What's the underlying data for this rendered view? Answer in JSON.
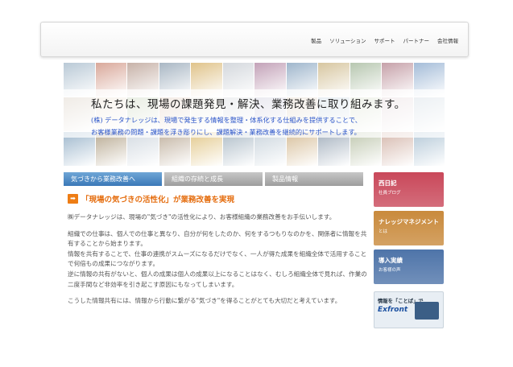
{
  "nav": [
    "製品",
    "ソリューション",
    "サポート",
    "パートナー",
    "会社情報"
  ],
  "hero": {
    "title": "私たちは、現場の課題発見・解決、業務改善に取り組みます。",
    "sub1": "(株) データナレッジは、現場で発生する情報を整理・体系化する仕組みを提供することで、",
    "sub2": "お客様業務の問題・課題を浮き彫りにし、課題解決・業務改善を継続的にサポートします。",
    "tile_colors": [
      "#b9c9d6",
      "#d9a89a",
      "#c7b2a8",
      "#a9b7c4",
      "#e0c38a",
      "#d4d8dd",
      "#c3a2b8",
      "#9fb6cc",
      "#d7c6a0",
      "#b7c7b0",
      "#c6a1a9",
      "#a4bcd8",
      "#c8b9a6",
      "#e6d6c2",
      "#b3c4a0",
      "#d2b6a0",
      "#e0e0d2",
      "#c8ccd2",
      "#b7b4cc",
      "#d0bfa8",
      "#aec3cf",
      "#c9d3b7",
      "#d9c7cb",
      "#bdcbd6",
      "#9fb8cd",
      "#b9ab93",
      "#d4dbe2",
      "#c2b3a1",
      "#e3c98d",
      "#b0bec9",
      "#ccd6de",
      "#d8c09c",
      "#a6b2bf",
      "#c1c9b1",
      "#d6b9ae",
      "#b5c9d8"
    ]
  },
  "tabs": [
    "気づきから業務改善へ",
    "組織の存続と成長",
    "製品情報"
  ],
  "main": {
    "headline": "「現場の気づきの活性化」が業務改善を実現",
    "paragraphs": [
      "㈱データナレッジは、現場の\"気づき\"の活性化により、お客様組織の業務改善をお手伝いします。",
      "組織での仕事は、個人での仕事と異なり、自分が何をしたのか、何をするつもりなのかを、関係者に情報を共有することから始まります。\n情報を共有することで、仕事の連携がスムーズになるだけでなく、一人が得た成果を組織全体で活用することで何倍もの成果につながります。\n逆に情報の共有がないと、個人の成果は個人の成果以上になることはなく、むしろ組織全体で見れば、作業の二度手間など非効率を引き起こす原因にもなってしまいます。",
      "こうした情報共有には、情報から行動に繋がる\"気づき\"を得ることがとても大切だと考えています。"
    ]
  },
  "side": [
    {
      "label": "西日記",
      "sub": "社員ブログ",
      "color": "#c9485a"
    },
    {
      "label": "ナレッジマネジメント",
      "sub": "とは",
      "color": "#c98a3c"
    },
    {
      "label": "導入実績",
      "sub": "お客様の声",
      "color": "#4e74a9"
    },
    {
      "label": "情報を「ことば」で",
      "sub": "Exfront",
      "color": "#e8eef4"
    }
  ]
}
